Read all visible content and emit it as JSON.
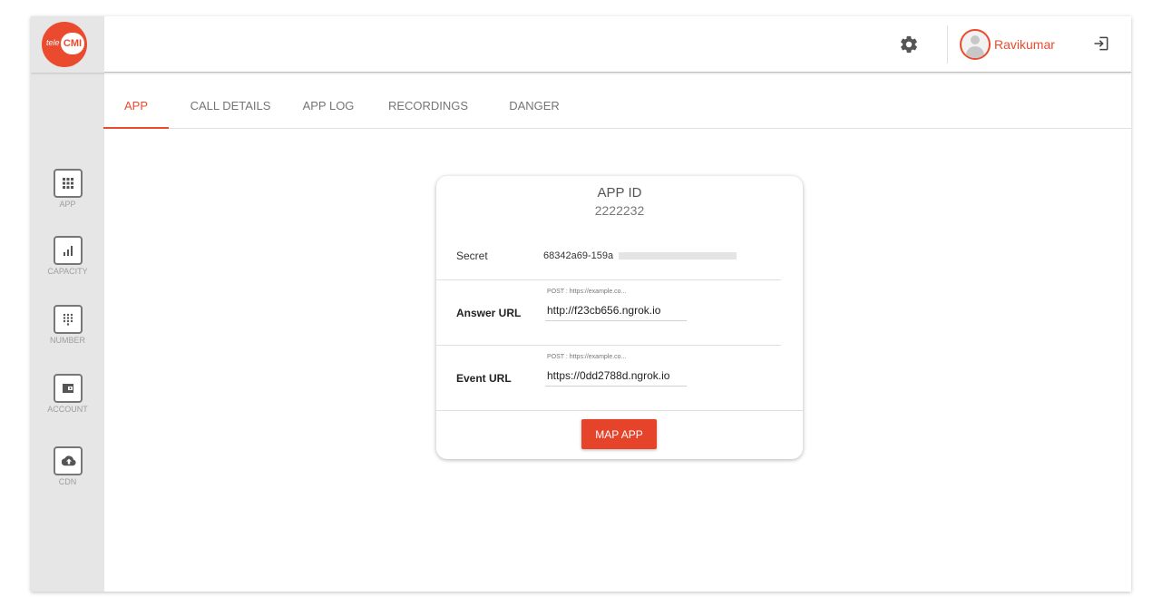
{
  "brand": {
    "logo_small": "tele",
    "logo_main": "CMI",
    "accent_color": "#ea4b2f"
  },
  "header": {
    "settings_icon": "gear-icon",
    "user_name": "Ravikumar",
    "logout_icon": "logout-icon"
  },
  "sidebar": {
    "items": [
      {
        "label": "APP",
        "icon": "grid-icon"
      },
      {
        "label": "CAPACITY",
        "icon": "bar-chart-icon"
      },
      {
        "label": "NUMBER",
        "icon": "dialpad-icon"
      },
      {
        "label": "ACCOUNT",
        "icon": "wallet-icon"
      },
      {
        "label": "CDN",
        "icon": "cloud-upload-icon"
      }
    ]
  },
  "tabs": [
    {
      "label": "APP",
      "active": true
    },
    {
      "label": "CALL DETAILS",
      "active": false
    },
    {
      "label": "APP LOG",
      "active": false
    },
    {
      "label": "RECORDINGS",
      "active": false
    },
    {
      "label": "DANGER",
      "active": false
    }
  ],
  "card": {
    "app_id_title": "APP ID",
    "app_id_value": "2222232",
    "secret_label": "Secret",
    "secret_value": "68342a69-159a",
    "answer_label": "Answer URL",
    "answer_hint": "POST : https://example.co...",
    "answer_value": "http://f23cb656.ngrok.io",
    "event_label": "Event URL",
    "event_hint": "POST : https://example.co...",
    "event_value": "https://0dd2788d.ngrok.io",
    "map_button": "MAP APP"
  }
}
